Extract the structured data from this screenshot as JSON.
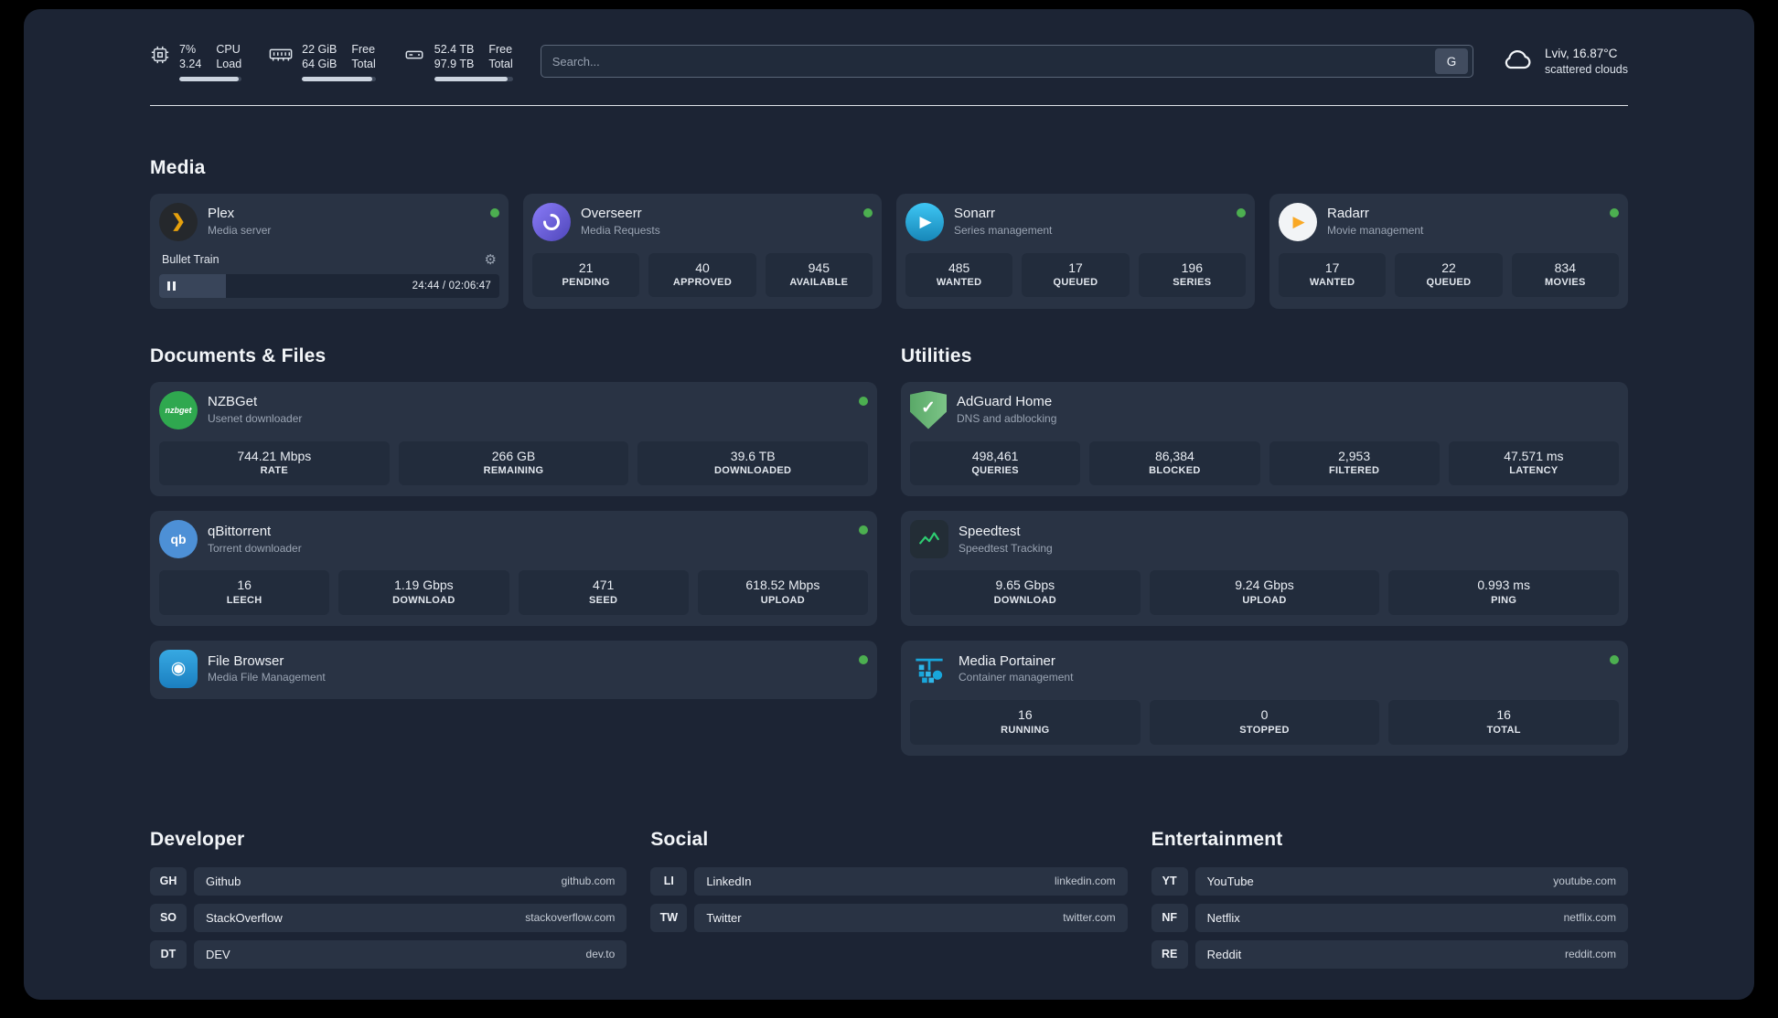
{
  "colors": {
    "status_green": "#4caf50",
    "plex_amber": "#e5a00d"
  },
  "icons": {
    "plex_glyph": "❯",
    "sonarr_glyph": "▶",
    "radarr_glyph": "▶",
    "filebrowser_glyph": "◉",
    "adguard_check": "✓",
    "gear": "⚙"
  },
  "topbar": {
    "cpu": {
      "value": "7%",
      "sub": "3.24",
      "label1": "CPU",
      "label2": "Load",
      "bar_style": "width:95%"
    },
    "ram": {
      "value": "22 GiB",
      "sub": "64 GiB",
      "label1": "Free",
      "label2": "Total",
      "bar_style": "width:95%"
    },
    "disk": {
      "value": "52.4 TB",
      "sub": "97.9 TB",
      "label1": "Free",
      "label2": "Total",
      "bar_style": "width:93%"
    },
    "search": {
      "placeholder": "Search...",
      "button": "G"
    },
    "weather": {
      "location": "Lviv, 16.87°C",
      "condition": "scattered clouds"
    }
  },
  "sections": {
    "media": "Media",
    "documents": "Documents & Files",
    "utilities": "Utilities",
    "developer": "Developer",
    "social": "Social",
    "entertainment": "Entertainment"
  },
  "services": {
    "plex": {
      "name": "Plex",
      "subtitle": "Media server",
      "track": "Bullet Train",
      "time": "24:44 / 02:06:47",
      "progress_style": "width:19.5%"
    },
    "overseerr": {
      "name": "Overseerr",
      "subtitle": "Media Requests",
      "stats": [
        {
          "value": "21",
          "label": "PENDING"
        },
        {
          "value": "40",
          "label": "APPROVED"
        },
        {
          "value": "945",
          "label": "AVAILABLE"
        }
      ]
    },
    "sonarr": {
      "name": "Sonarr",
      "subtitle": "Series management",
      "stats": [
        {
          "value": "485",
          "label": "WANTED"
        },
        {
          "value": "17",
          "label": "QUEUED"
        },
        {
          "value": "196",
          "label": "SERIES"
        }
      ]
    },
    "radarr": {
      "name": "Radarr",
      "subtitle": "Movie management",
      "stats": [
        {
          "value": "17",
          "label": "WANTED"
        },
        {
          "value": "22",
          "label": "QUEUED"
        },
        {
          "value": "834",
          "label": "MOVIES"
        }
      ]
    },
    "nzbget": {
      "name": "NZBGet",
      "subtitle": "Usenet downloader",
      "icon_text": "nzbget",
      "stats": [
        {
          "value": "744.21 Mbps",
          "label": "RATE"
        },
        {
          "value": "266 GB",
          "label": "REMAINING"
        },
        {
          "value": "39.6 TB",
          "label": "DOWNLOADED"
        }
      ]
    },
    "qbittorrent": {
      "name": "qBittorrent",
      "subtitle": "Torrent downloader",
      "icon_text": "qb",
      "stats": [
        {
          "value": "16",
          "label": "LEECH"
        },
        {
          "value": "1.19 Gbps",
          "label": "DOWNLOAD"
        },
        {
          "value": "471",
          "label": "SEED"
        },
        {
          "value": "618.52 Mbps",
          "label": "UPLOAD"
        }
      ]
    },
    "filebrowser": {
      "name": "File Browser",
      "subtitle": "Media File Management"
    },
    "adguard": {
      "name": "AdGuard Home",
      "subtitle": "DNS and adblocking",
      "stats": [
        {
          "value": "498,461",
          "label": "QUERIES"
        },
        {
          "value": "86,384",
          "label": "BLOCKED"
        },
        {
          "value": "2,953",
          "label": "FILTERED"
        },
        {
          "value": "47.571 ms",
          "label": "LATENCY"
        }
      ]
    },
    "speedtest": {
      "name": "Speedtest",
      "subtitle": "Speedtest Tracking",
      "stats": [
        {
          "value": "9.65 Gbps",
          "label": "DOWNLOAD"
        },
        {
          "value": "9.24 Gbps",
          "label": "UPLOAD"
        },
        {
          "value": "0.993 ms",
          "label": "PING"
        }
      ]
    },
    "portainer": {
      "name": "Media Portainer",
      "subtitle": "Container management",
      "stats": [
        {
          "value": "16",
          "label": "RUNNING"
        },
        {
          "value": "0",
          "label": "STOPPED"
        },
        {
          "value": "16",
          "label": "TOTAL"
        }
      ]
    }
  },
  "bookmarks": {
    "developer": [
      {
        "abbr": "GH",
        "name": "Github",
        "url": "github.com"
      },
      {
        "abbr": "SO",
        "name": "StackOverflow",
        "url": "stackoverflow.com"
      },
      {
        "abbr": "DT",
        "name": "DEV",
        "url": "dev.to"
      }
    ],
    "social": [
      {
        "abbr": "LI",
        "name": "LinkedIn",
        "url": "linkedin.com"
      },
      {
        "abbr": "TW",
        "name": "Twitter",
        "url": "twitter.com"
      }
    ],
    "entertainment": [
      {
        "abbr": "YT",
        "name": "YouTube",
        "url": "youtube.com"
      },
      {
        "abbr": "NF",
        "name": "Netflix",
        "url": "netflix.com"
      },
      {
        "abbr": "RE",
        "name": "Reddit",
        "url": "reddit.com"
      }
    ]
  }
}
